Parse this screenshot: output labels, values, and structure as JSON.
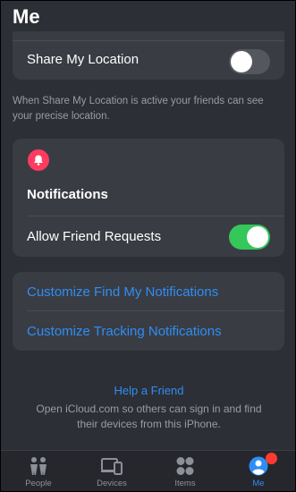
{
  "header": {
    "title": "Me"
  },
  "location": {
    "label": "Share My Location",
    "enabled": false,
    "footnote": "When Share My Location is active your friends can see your precise location."
  },
  "notifications": {
    "icon": "bell-icon",
    "title": "Notifications",
    "allow_label": "Allow Friend Requests",
    "allow_enabled": true
  },
  "links": {
    "find_my": "Customize Find My Notifications",
    "tracking": "Customize Tracking Notifications"
  },
  "help": {
    "link": "Help a Friend",
    "text": "Open iCloud.com so others can sign in and find their devices from this iPhone."
  },
  "tabs": [
    {
      "label": "People",
      "icon": "people-icon",
      "active": false
    },
    {
      "label": "Devices",
      "icon": "devices-icon",
      "active": false
    },
    {
      "label": "Items",
      "icon": "items-icon",
      "active": false
    },
    {
      "label": "Me",
      "icon": "me-icon",
      "active": true,
      "badge": true
    }
  ],
  "colors": {
    "accent": "#2e8ef5",
    "toggle_on": "#34c759",
    "bell": "#ff3b5f",
    "badge": "#ff3b30"
  }
}
